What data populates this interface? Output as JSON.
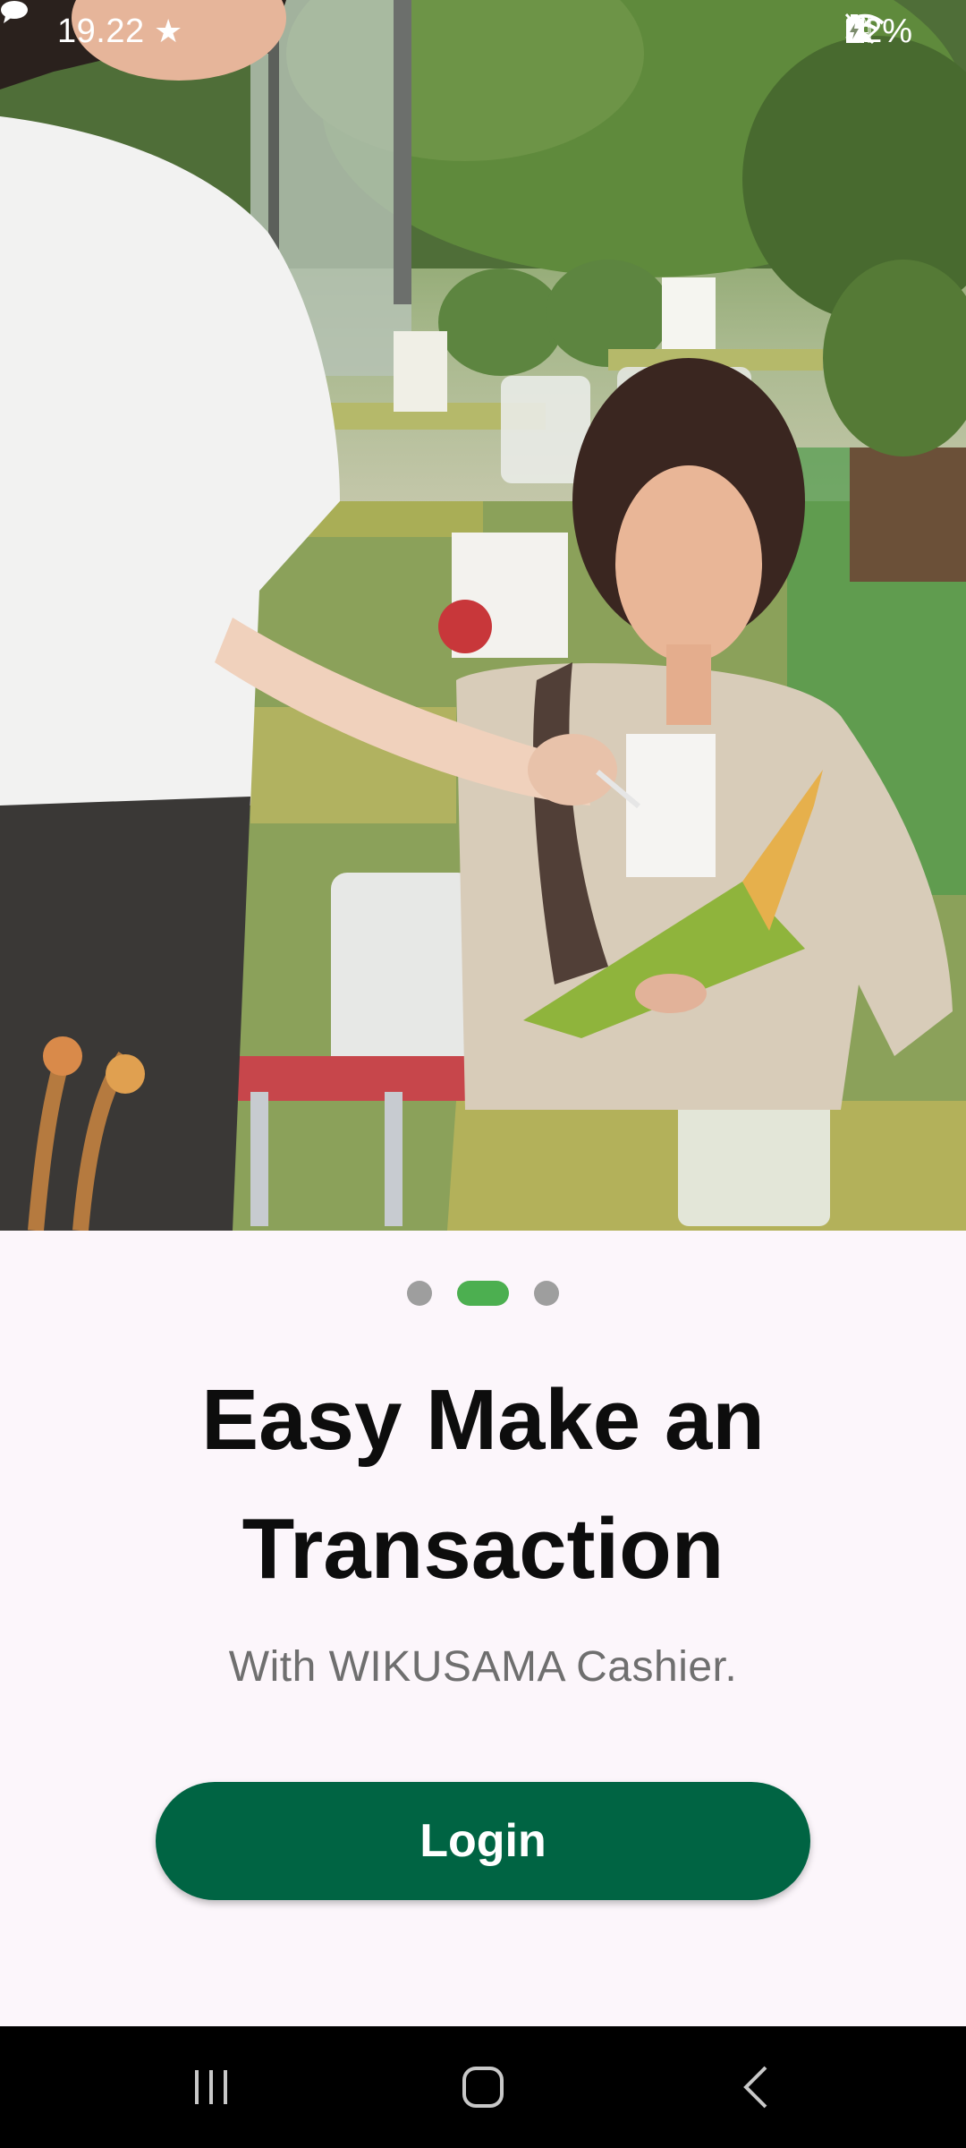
{
  "status_bar": {
    "time": "19.22",
    "battery": "52%",
    "icons": [
      "star-icon",
      "chat-bubble-icon",
      "mute-icon",
      "wifi-icon",
      "volte-icon",
      "signal-icon",
      "battery-icon"
    ]
  },
  "onboarding": {
    "page_count": 3,
    "active_page": 2,
    "title": "Easy Make an Transaction",
    "subtitle": "With WIKUSAMA Cashier.",
    "login_label": "Login"
  },
  "nav_bar": {
    "icons": [
      "recent-apps-icon",
      "home-icon",
      "back-icon"
    ]
  },
  "colors": {
    "background": "#fcf6fb",
    "primary_button": "#006443",
    "active_dot": "#4caf50",
    "inactive_dot": "#9e9e9e",
    "title_text": "#0d0d0d",
    "subtitle_text": "#6f6f6f"
  }
}
